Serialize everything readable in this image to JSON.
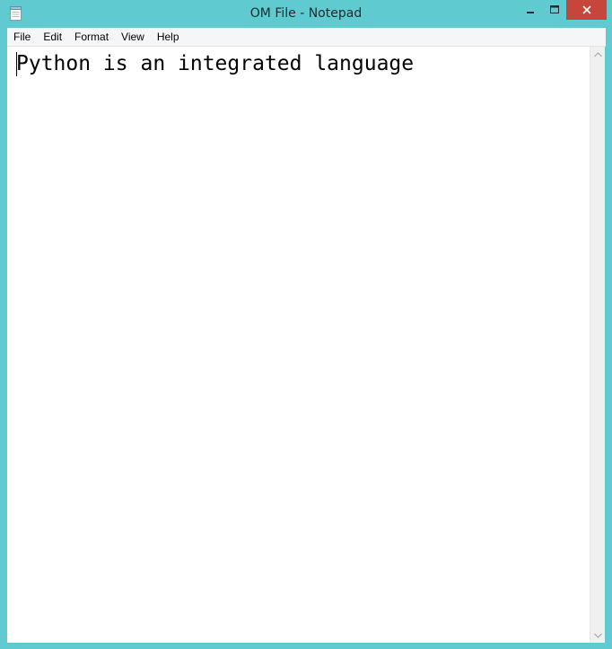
{
  "window": {
    "title": "OM File - Notepad",
    "accent_color": "#5fcbd0",
    "close_color": "#c7463b"
  },
  "menu": {
    "items": [
      "File",
      "Edit",
      "Format",
      "View",
      "Help"
    ]
  },
  "editor": {
    "text": "Python is an integrated language"
  },
  "icons": {
    "app": "notepad-icon",
    "minimize": "minimize-icon",
    "maximize": "maximize-icon",
    "close": "close-icon",
    "scroll_up": "chevron-up-icon",
    "scroll_down": "chevron-down-icon"
  }
}
